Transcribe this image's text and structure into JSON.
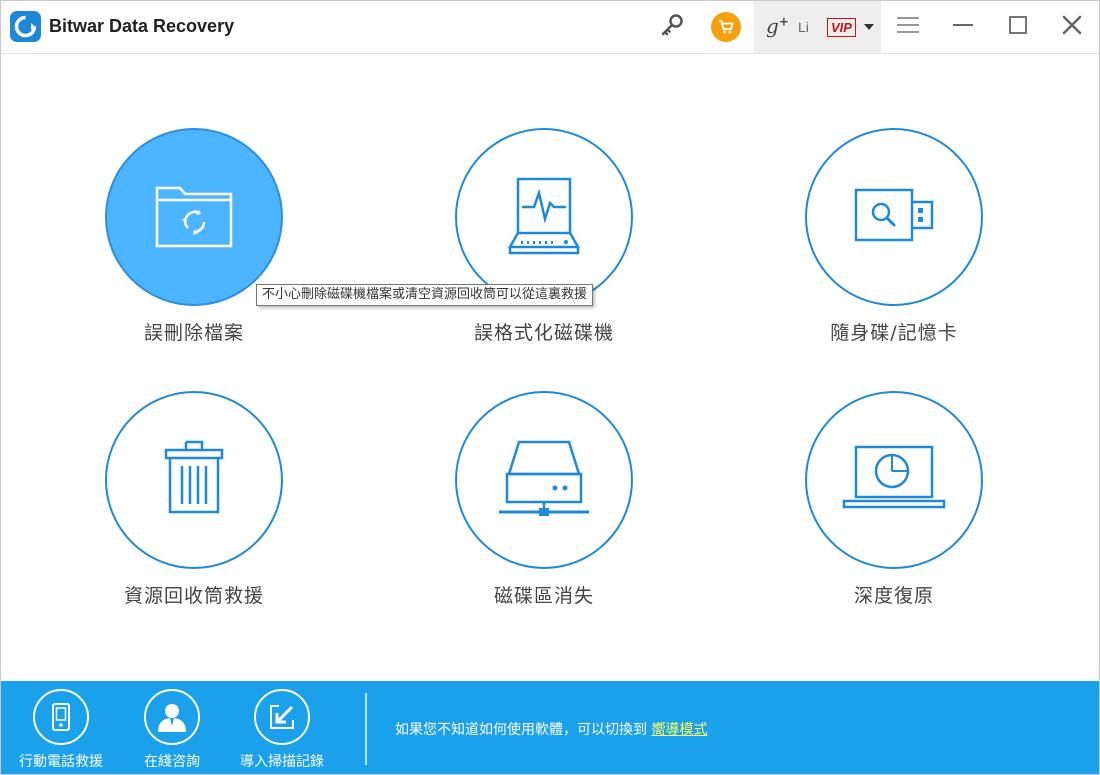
{
  "titlebar": {
    "app_title": "Bitwar Data Recovery",
    "icons": [
      "key-icon",
      "cart-icon",
      "google-plus-icon",
      "menu-icon",
      "minimize-icon",
      "maximize-icon",
      "close-icon"
    ],
    "gplus_text": "g",
    "gplus_sup": "+",
    "user_name": "Li",
    "vip_badge": "VIP"
  },
  "colors": {
    "accent": "#1e8ad6",
    "active_fill": "#4db5ff",
    "bottom_bar": "#1ba1eb",
    "cart": "#f5a10f",
    "vip": "#c0141a",
    "link": "#ffff60"
  },
  "modes": [
    {
      "label": "誤刪除檔案",
      "icon": "recycle-folder-icon",
      "active": true
    },
    {
      "label": "誤格式化磁碟機",
      "icon": "drive-pulse-icon",
      "active": false
    },
    {
      "label": "隨身碟/記憶卡",
      "icon": "usb-drive-icon",
      "active": false
    },
    {
      "label": "資源回收筒救援",
      "icon": "trash-bin-icon",
      "active": false
    },
    {
      "label": "磁碟區消失",
      "icon": "network-drive-icon",
      "active": false
    },
    {
      "label": "深度復原",
      "icon": "laptop-scan-icon",
      "active": false
    }
  ],
  "tooltip": "不小心刪除磁碟機檔案或清空資源回收筒可以從這裏救援",
  "bottom": {
    "items": [
      {
        "label": "行動電話救援",
        "icon": "phone-icon"
      },
      {
        "label": "在綫咨詢",
        "icon": "support-agent-icon"
      },
      {
        "label": "導入掃描記錄",
        "icon": "import-icon"
      }
    ],
    "hint_text": "如果您不知道如何使用軟體，可以切換到",
    "hint_link": "嚮導模式"
  }
}
